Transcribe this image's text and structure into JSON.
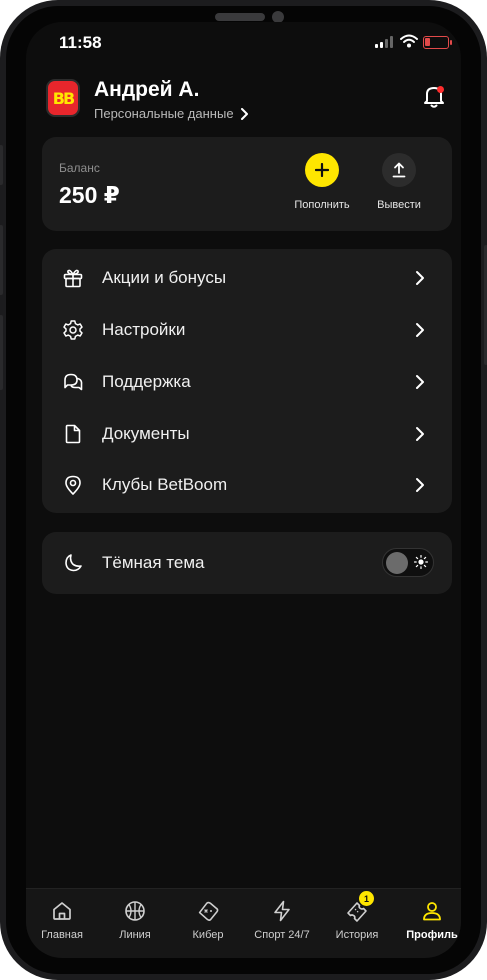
{
  "status_bar": {
    "time": "11:58"
  },
  "profile": {
    "logo_text": "BB",
    "name": "Андрей А.",
    "personal_data_link": "Персональные данные",
    "notifications_unread": true
  },
  "balance": {
    "label": "Баланс",
    "value": "250 ₽",
    "deposit_label": "Пополнить",
    "withdraw_label": "Вывести"
  },
  "menu": {
    "items": [
      {
        "label": "Акции и бонусы",
        "icon": "gift-icon"
      },
      {
        "label": "Настройки",
        "icon": "gear-icon"
      },
      {
        "label": "Поддержка",
        "icon": "chat-bubbles-icon"
      },
      {
        "label": "Документы",
        "icon": "document-icon"
      },
      {
        "label": "Клубы BetBoom",
        "icon": "map-pin-icon"
      }
    ]
  },
  "theme": {
    "label": "Тёмная тема",
    "enabled": false,
    "icon": "moon-icon"
  },
  "bottom_nav": {
    "items": [
      {
        "label": "Главная",
        "icon": "home-icon"
      },
      {
        "label": "Линия",
        "icon": "basketball-icon"
      },
      {
        "label": "Кибер",
        "icon": "gamepad-icon"
      },
      {
        "label": "Спорт 24/7",
        "icon": "lightning-icon"
      },
      {
        "label": "История",
        "icon": "ticket-icon",
        "badge": "1"
      },
      {
        "label": "Профиль",
        "icon": "user-icon",
        "active": true
      }
    ]
  },
  "colors": {
    "accent": "#ffe600",
    "background": "#0d0d0d",
    "card": "#1c1c1c",
    "notification_dot": "#ff2d2d"
  }
}
